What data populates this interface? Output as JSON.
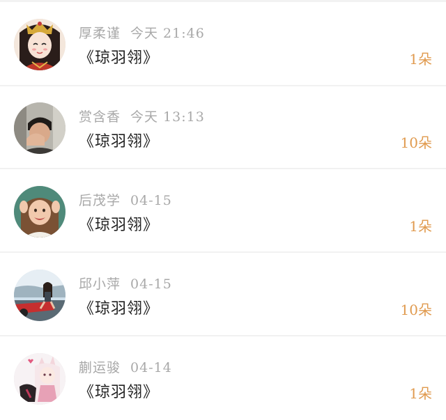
{
  "gift_list": {
    "items": [
      {
        "name": "厚柔谨",
        "time": "今天 21:46",
        "gift": "《琼羽翎》",
        "count": "1朵",
        "avatar_icon": "costume-girl-avatar"
      },
      {
        "name": "赏含香",
        "time": "今天 13:13",
        "gift": "《琼羽翎》",
        "count": "10朵",
        "avatar_icon": "boy-covering-face-avatar"
      },
      {
        "name": "后茂学",
        "time": "04-15",
        "gift": "《琼羽翎》",
        "count": "1朵",
        "avatar_icon": "smiling-girl-avatar"
      },
      {
        "name": "邱小萍",
        "time": "04-15",
        "gift": "《琼羽翎》",
        "count": "10朵",
        "avatar_icon": "girl-on-red-car-avatar"
      },
      {
        "name": "蒯运骏",
        "time": "04-14",
        "gift": "《琼羽翎》",
        "count": "1朵",
        "avatar_icon": "anime-fox-girl-avatar"
      }
    ]
  },
  "colors": {
    "count_accent": "#e09a4e",
    "meta_gray": "#a8a8a8",
    "title_text": "#222222",
    "separator": "#f1f1f1"
  }
}
